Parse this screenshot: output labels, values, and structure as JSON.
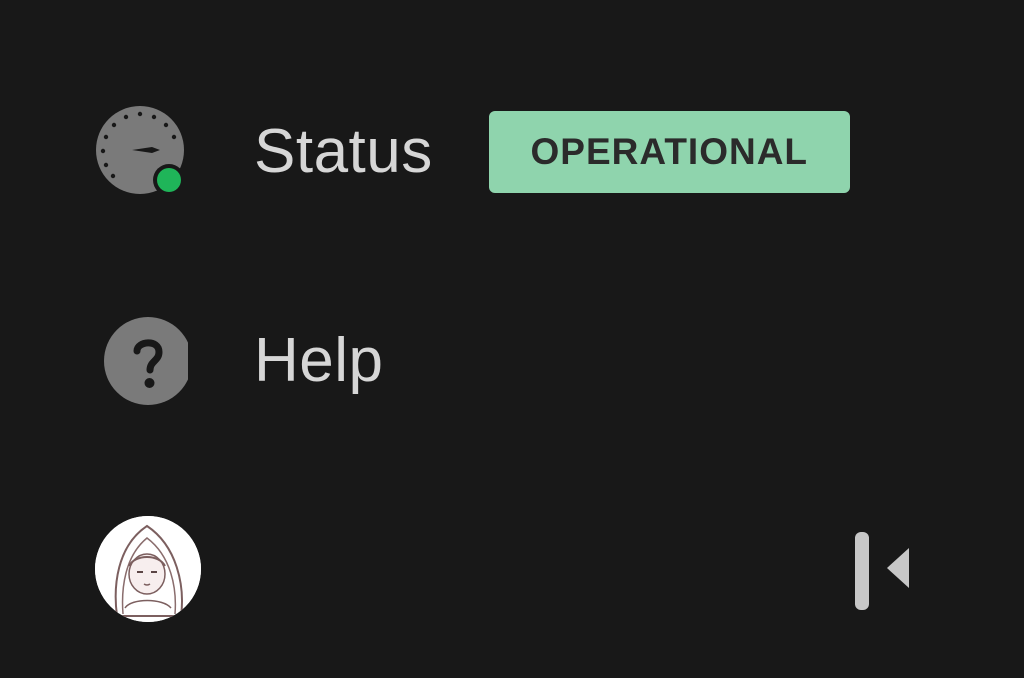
{
  "nav": {
    "items": [
      {
        "label": "Status",
        "icon": "speedometer-icon",
        "badge": {
          "text": "OPERATIONAL",
          "color": "#8fd4ad"
        },
        "indicator_color": "#1fb559"
      },
      {
        "label": "Help",
        "icon": "question-circle-icon"
      }
    ]
  },
  "footer": {
    "avatar_icon": "user-avatar",
    "collapse_icon": "collapse-sidebar-icon"
  },
  "colors": {
    "background": "#181818",
    "text": "#d6d6d6",
    "icon": "#7a7a7a"
  }
}
